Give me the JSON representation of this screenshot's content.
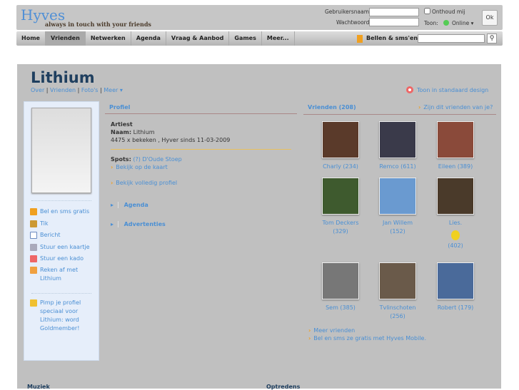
{
  "header": {
    "logo": "Hyves",
    "tagline": "always in touch with your friends",
    "username_label": "Gebruikersnaam:",
    "password_label": "Wachtwoord:",
    "remember_label": "Onthoud mij",
    "show_label": "Toon:",
    "status": "Online",
    "ok_label": "Ok"
  },
  "nav": {
    "tabs": [
      "Home",
      "Vrienden",
      "Netwerken",
      "Agenda",
      "Vraag & Aanbod",
      "Games",
      "Meer..."
    ],
    "calls": "Bellen & sms'en",
    "search_placeholder": ""
  },
  "profile": {
    "name": "Lithium",
    "links": [
      "Over",
      "Vrienden",
      "Foto's",
      "Meer"
    ],
    "standard_design": "Toon in standaard design",
    "sidebar": [
      "Bel en sms gratis",
      "Tik",
      "Bericht",
      "Stuur een kaartje",
      "Stuur een kado",
      "Reken af met Lithium"
    ],
    "pimp": "Pimp je profiel speciaal voor Lithium: word Goldmember!",
    "section_title": "Profiel",
    "type": "Artiest",
    "naam_label": "Naam:",
    "naam": "Lithium",
    "stats": "4475 x bekeken , Hyver sinds 11-03-2009",
    "spots_label": "Spots:",
    "spots": "(?) D'Oude Stoep",
    "map_link": "Bekijk op de kaart",
    "full_profile": "Bekijk volledig profiel",
    "agenda": "Agenda",
    "ads": "Advertenties"
  },
  "friends": {
    "title": "Vrienden (208)",
    "are_friends": "Zijn dit vrienden van je?",
    "list": [
      {
        "name": "Charly (234)",
        "color": "#5a3a2a"
      },
      {
        "name": "Remco (611)",
        "color": "#3a3a4a"
      },
      {
        "name": "Eileen (389)",
        "color": "#8a4a3a"
      },
      {
        "name": "Tom Deckers (329)",
        "color": "#3e5a2e"
      },
      {
        "name": "Jan Willem (152)",
        "color": "#6a9ad0"
      },
      {
        "name": "Lies.",
        "extra": "(402)",
        "color": "#4a3a2a"
      },
      {
        "name": "Sem (385)",
        "color": "#777777"
      },
      {
        "name": "Tvlinschoten (256)",
        "color": "#6a5a4a"
      },
      {
        "name": "Robert (179)",
        "color": "#4a6a9a"
      }
    ],
    "more": "Meer vrienden",
    "mobile": "Bel en sms ze gratis met Hyves Mobile."
  },
  "bottom": {
    "music": "Muziek",
    "shows": "Optredens"
  }
}
